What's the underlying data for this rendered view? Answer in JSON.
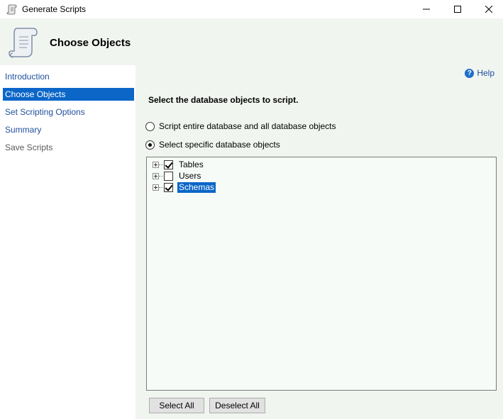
{
  "window": {
    "title": "Generate Scripts",
    "icon": "scroll-icon"
  },
  "header": {
    "title": "Choose Objects",
    "icon": "scroll-icon"
  },
  "nav": {
    "items": [
      {
        "label": "Introduction",
        "state": "normal"
      },
      {
        "label": "Choose Objects",
        "state": "active"
      },
      {
        "label": "Set Scripting Options",
        "state": "normal"
      },
      {
        "label": "Summary",
        "state": "normal"
      },
      {
        "label": "Save Scripts",
        "state": "disabled"
      }
    ]
  },
  "main": {
    "help_label": "Help",
    "prompt": "Select the database objects to script.",
    "options": [
      {
        "label": "Script entire database and all database objects",
        "selected": false
      },
      {
        "label": "Select specific database objects",
        "selected": true
      }
    ],
    "tree": [
      {
        "label": "Tables",
        "checked": true,
        "selected": false
      },
      {
        "label": "Users",
        "checked": false,
        "selected": false
      },
      {
        "label": "Schemas",
        "checked": true,
        "selected": true
      }
    ],
    "buttons": {
      "select_all": "Select All",
      "deselect_all": "Deselect All"
    }
  },
  "colors": {
    "accent": "#0b66c8",
    "link": "#1f4f9c",
    "panel_bg": "#f1f5f0"
  }
}
